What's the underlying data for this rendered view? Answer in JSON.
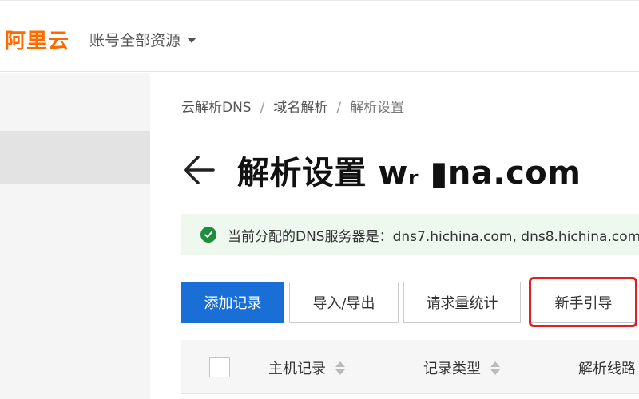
{
  "header": {
    "logo_text": "阿里云",
    "account_menu_label": "账号全部资源"
  },
  "breadcrumb": {
    "items": [
      "云解析DNS",
      "域名解析",
      "解析设置"
    ],
    "separator": "/"
  },
  "page": {
    "title": "解析设置 wᵣ ▮na.com"
  },
  "notice": {
    "text": "当前分配的DNS服务器是：dns7.hichina.com, dns8.hichina.com"
  },
  "toolbar": {
    "add_record_label": "添加记录",
    "import_export_label": "导入/导出",
    "request_stats_label": "请求量统计",
    "guide_label": "新手引导"
  },
  "table": {
    "columns": [
      "主机记录",
      "记录类型",
      "解析线路"
    ]
  },
  "colors": {
    "brand": "#ff6a00",
    "primary": "#1a6fd6",
    "success": "#1e8e3e",
    "highlight": "#e02020"
  },
  "icons": [
    "caret-down-icon",
    "back-arrow-icon",
    "check-circle-icon",
    "sort-icon"
  ]
}
